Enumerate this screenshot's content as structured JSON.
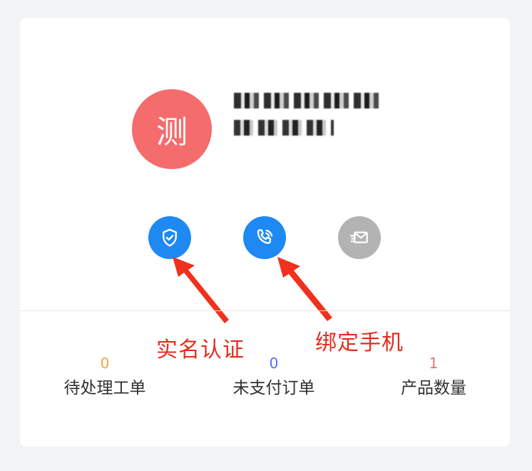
{
  "profile": {
    "avatar_text": "测",
    "avatar_color": "#f56c6c"
  },
  "icons": {
    "auth": "shield-check-icon",
    "phone": "phone-icon",
    "mail": "mail-icon",
    "active_color": "#1e88f3",
    "inactive_color": "#b3b3b3"
  },
  "annotations": {
    "auth": "实名认证",
    "phone": "绑定手机",
    "color": "#e52b1c"
  },
  "stats": [
    {
      "value": "0",
      "label": "待处理工单",
      "color": "#f0a43a"
    },
    {
      "value": "0",
      "label": "未支付订单",
      "color": "#5a6cf0"
    },
    {
      "value": "1",
      "label": "产品数量",
      "color": "#f56c6c"
    }
  ]
}
